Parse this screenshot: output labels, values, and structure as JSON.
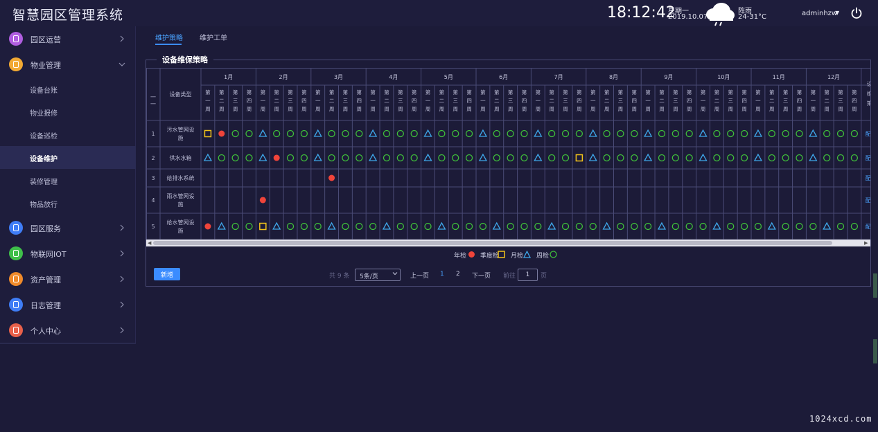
{
  "header": {
    "title": "智慧园区管理系统",
    "time": "18:12:42",
    "weekday": "星期一",
    "date": "2019.10.07",
    "weather": "阵雨",
    "temperature": "24-31°C",
    "user": "adminhzw",
    "icons": {
      "weather": "cloud-rain-icon",
      "power": "power-icon",
      "caret": "caret-down-icon"
    }
  },
  "sidebar": {
    "items": [
      {
        "label": "园区运营",
        "icon": "building-icon",
        "color": "#b05ee0"
      },
      {
        "label": "物业管理",
        "icon": "lightbulb-icon",
        "color": "#f2a933",
        "expanded": true
      },
      {
        "label": "园区服务",
        "icon": "service-icon",
        "color": "#3f7df6"
      },
      {
        "label": "物联网IOT",
        "icon": "shield-icon",
        "color": "#3fbf4a"
      },
      {
        "label": "资产管理",
        "icon": "asset-icon",
        "color": "#f08a2a"
      },
      {
        "label": "日志管理",
        "icon": "log-icon",
        "color": "#3f7df6"
      },
      {
        "label": "个人中心",
        "icon": "person-icon",
        "color": "#e8604a"
      }
    ],
    "subitems": [
      "设备台账",
      "物业报修",
      "设备巡检",
      "设备维护",
      "装修管理",
      "物品放行"
    ],
    "active_subitem": "设备维护"
  },
  "tabs": [
    "维护策略",
    "维护工单"
  ],
  "active_tab": "维护策略",
  "panel": {
    "title": "设备维保策略"
  },
  "table": {
    "index_header": "一一",
    "type_header": "设备类型",
    "extra_header": "设维策",
    "months": [
      "1月",
      "2月",
      "3月",
      "4月",
      "5月",
      "6月",
      "7月",
      "8月",
      "9月",
      "10月",
      "11月",
      "12月"
    ],
    "weeks": [
      "第一周",
      "第二周",
      "第三周",
      "第四周"
    ],
    "rows": [
      {
        "index": "1",
        "type": "污水管网设施",
        "action": "配",
        "marks": [
          "S",
          "R",
          "C",
          "C",
          "T",
          "C",
          "C",
          "C",
          "T",
          "C",
          "C",
          "C",
          "T",
          "C",
          "C",
          "C",
          "T",
          "C",
          "C",
          "C",
          "T",
          "C",
          "C",
          "C",
          "T",
          "C",
          "C",
          "C",
          "T",
          "C",
          "C",
          "C",
          "T",
          "C",
          "C",
          "C",
          "T",
          "C",
          "C",
          "C",
          "T",
          "C",
          "C",
          "C",
          "T",
          "C",
          "C",
          "C"
        ]
      },
      {
        "index": "2",
        "type": "供水水箱",
        "action": "配",
        "marks": [
          "T",
          "C",
          "C",
          "C",
          "T",
          "R",
          "C",
          "C",
          "T",
          "C",
          "C",
          "C",
          "T",
          "C",
          "C",
          "C",
          "T",
          "C",
          "C",
          "C",
          "T",
          "C",
          "C",
          "C",
          "T",
          "C",
          "C",
          "S",
          "T",
          "C",
          "C",
          "C",
          "T",
          "C",
          "C",
          "C",
          "T",
          "C",
          "C",
          "C",
          "T",
          "C",
          "C",
          "C",
          "T",
          "C",
          "C",
          "C"
        ]
      },
      {
        "index": "3",
        "type": "给排水系统",
        "action": "配",
        "marks": [
          "",
          "",
          "",
          "",
          "",
          "",
          "",
          "",
          "",
          "R",
          "",
          "",
          "",
          "",
          "",
          "",
          "",
          "",
          "",
          "",
          "",
          "",
          "",
          "",
          "",
          "",
          "",
          "",
          "",
          "",
          "",
          "",
          "",
          "",
          "",
          "",
          "",
          "",
          "",
          "",
          "",
          "",
          "",
          "",
          "",
          "",
          "",
          ""
        ]
      },
      {
        "index": "4",
        "type": "雨水管网设施",
        "action": "配",
        "marks": [
          "",
          "",
          "",
          "",
          "R",
          "",
          "",
          "",
          "",
          "",
          "",
          "",
          "",
          "",
          "",
          "",
          "",
          "",
          "",
          "",
          "",
          "",
          "",
          "",
          "",
          "",
          "",
          "",
          "",
          "",
          "",
          "",
          "",
          "",
          "",
          "",
          "",
          "",
          "",
          "",
          "",
          "",
          "",
          "",
          "",
          "",
          "",
          ""
        ]
      },
      {
        "index": "5",
        "type": "给水管网设施",
        "action": "配",
        "marks": [
          "R",
          "T",
          "C",
          "C",
          "S",
          "T",
          "C",
          "C",
          "C",
          "T",
          "C",
          "C",
          "C",
          "T",
          "C",
          "C",
          "C",
          "T",
          "C",
          "C",
          "C",
          "T",
          "C",
          "C",
          "C",
          "T",
          "C",
          "C",
          "C",
          "T",
          "C",
          "C",
          "C",
          "T",
          "C",
          "C",
          "C",
          "T",
          "C",
          "C",
          "C",
          "T",
          "C",
          "C",
          "C",
          "T",
          "C",
          "C"
        ]
      }
    ]
  },
  "legend": [
    {
      "label": "年检",
      "mark": "R"
    },
    {
      "label": "季度检",
      "mark": "S"
    },
    {
      "label": "月检",
      "mark": "T"
    },
    {
      "label": "周检",
      "mark": "C"
    }
  ],
  "colors": {
    "annual": "#f0443a",
    "quarterly": "#f2c31a",
    "monthly": "#3ea6e8",
    "weekly": "#3fbf3a",
    "accent": "#3b8cff"
  },
  "pagination": {
    "add_label": "新增",
    "total": "共 9 条",
    "page_size": "5条/页",
    "prev": "上一页",
    "pages": [
      "1",
      "2"
    ],
    "current_page": "1",
    "next": "下一页",
    "goto_label": "前往",
    "goto_value": "1",
    "goto_unit": "页"
  },
  "watermark": "1024xcd.com"
}
